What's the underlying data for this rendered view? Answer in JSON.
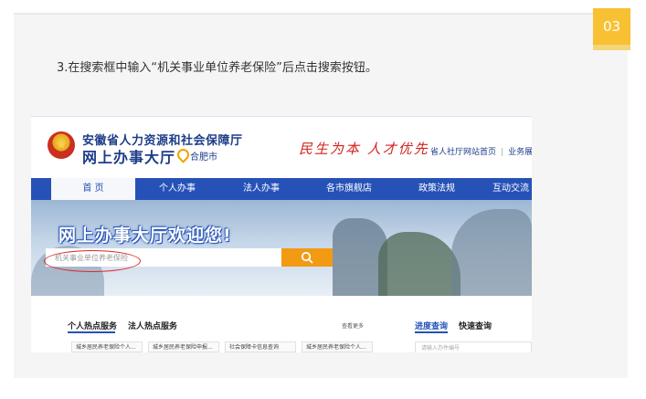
{
  "badge": "03",
  "instruction": "3.在搜索框中输入“机关事业单位养老保险”后点击搜索按钮。",
  "site": {
    "org_name": "安徽省人力资源和社会保障厅",
    "hall_name": "网上办事大厅",
    "city": "合肥市",
    "slogan": "民生为本 人才优先",
    "top_links": [
      "省人社厅网站首页",
      "业务展示"
    ],
    "separator": "|"
  },
  "nav": {
    "items": [
      "首 页",
      "个人办事",
      "法人办事",
      "各市旗舰店",
      "政策法规",
      "互动交流"
    ]
  },
  "banner": {
    "title": "网上办事大厅欢迎您!",
    "search_value": "机关事业单位养老保险"
  },
  "services": {
    "tab_personal": "个人热点服务",
    "tab_legal": "法人热点服务",
    "more": "查看更多",
    "chips": [
      "城乡居民养老保险个人...",
      "城乡居民养老保险申报...",
      "社会保障卡信息查询",
      "城乡居民养老保险个人..."
    ]
  },
  "side": {
    "tab_progress": "进度查询",
    "tab_quick": "快速查询",
    "input_placeholder": "请输入办件编号"
  },
  "colors": {
    "accent": "#2652b8",
    "badge": "#f7c133",
    "search_button": "#f29a12",
    "highlight": "#e02525",
    "slogan": "#d2231e"
  }
}
